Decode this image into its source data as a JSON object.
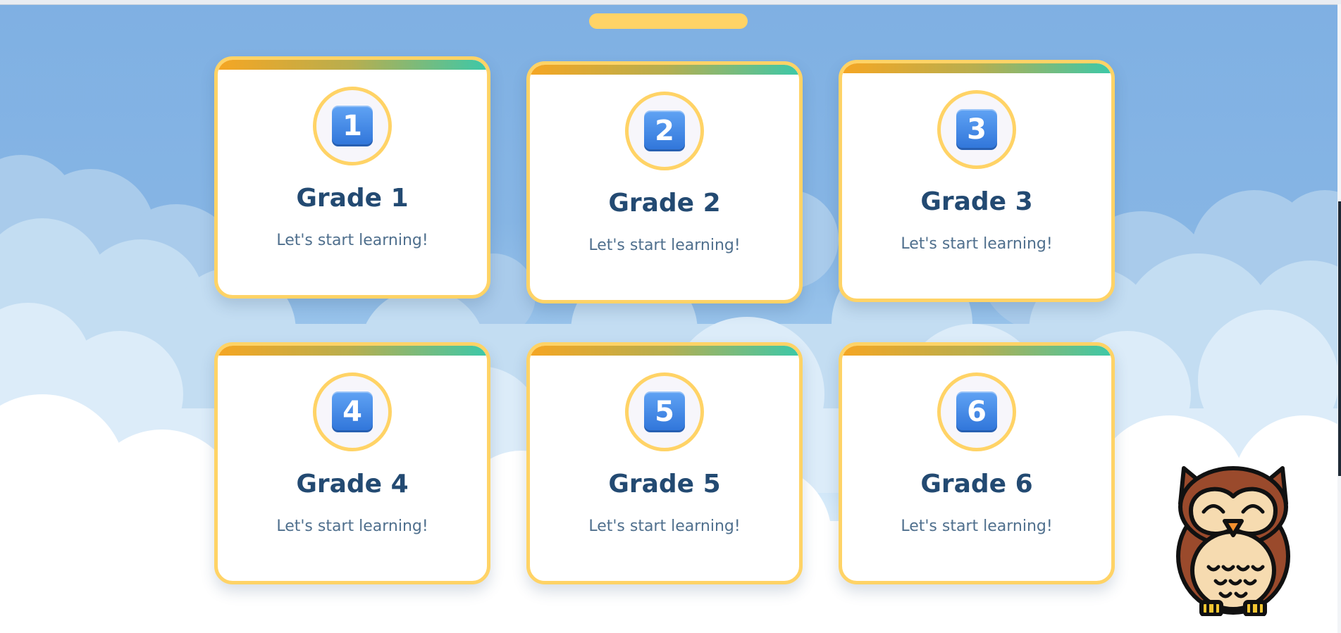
{
  "grades": [
    {
      "number": "1",
      "title": "Grade 1",
      "subtitle": "Let's start learning!"
    },
    {
      "number": "2",
      "title": "Grade 2",
      "subtitle": "Let's start learning!"
    },
    {
      "number": "3",
      "title": "Grade 3",
      "subtitle": "Let's start learning!"
    },
    {
      "number": "4",
      "title": "Grade 4",
      "subtitle": "Let's start learning!"
    },
    {
      "number": "5",
      "title": "Grade 5",
      "subtitle": "Let's start learning!"
    },
    {
      "number": "6",
      "title": "Grade 6",
      "subtitle": "Let's start learning!"
    }
  ],
  "colors": {
    "sky": "#7fb0e3",
    "card_border": "#ffd366",
    "title_text": "#234a72",
    "subtitle_text": "#4f6f8d",
    "number_tile": "#3d86e8",
    "bar_start": "#f5a623",
    "bar_end": "#3dc8a8"
  },
  "icons": {
    "mascot": "owl-mascot-icon",
    "number": "number-keycap-icon"
  }
}
